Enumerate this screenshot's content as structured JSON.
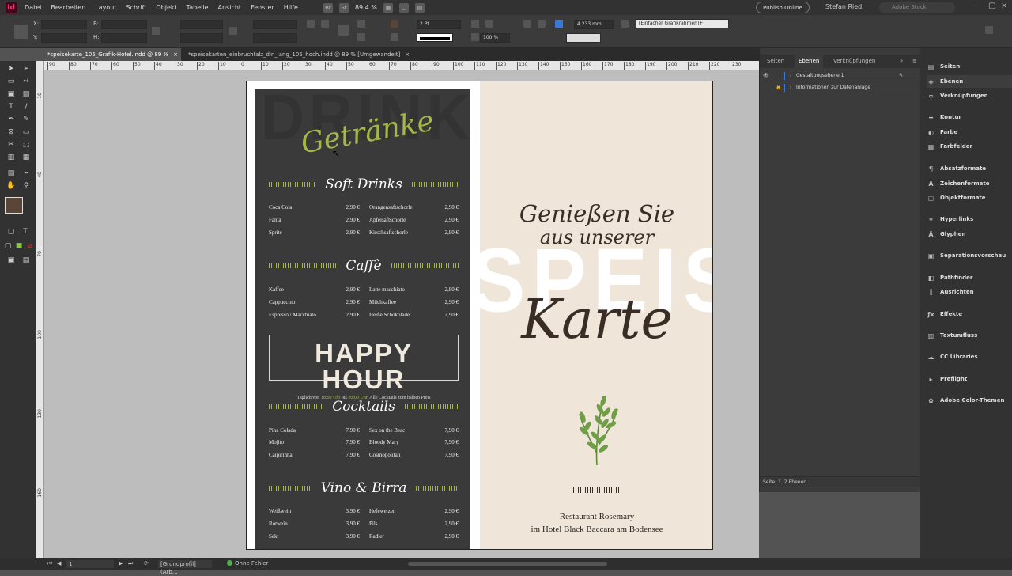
{
  "app": {
    "logo": "Id"
  },
  "menu": [
    "Datei",
    "Bearbeiten",
    "Layout",
    "Schrift",
    "Objekt",
    "Tabelle",
    "Ansicht",
    "Fenster",
    "Hilfe"
  ],
  "toolbar_top": {
    "mode_btn1": "Br",
    "mode_btn2": "St",
    "zoom": "89,4 %",
    "publish": "Publish Online",
    "user": "Stefan Riedl",
    "search_placeholder": "Adobe Stock"
  },
  "control": {
    "x_label": "X:",
    "y_label": "Y:",
    "w_label": "B:",
    "h_label": "H:",
    "stroke_weight": "2 Pt",
    "offset": "4,233 mm",
    "scale": "100 %",
    "object_style": "[Einfacher Grafikrahmen]+"
  },
  "tabs": [
    {
      "label": "*speisekarte_105_Grafik-Hotel.indd @ 89 %",
      "close": "×"
    },
    {
      "label": "*speisekarten_einbruchfalz_din_lang_105_hoch.indd @ 89 % [Umgewandelt]",
      "close": "×"
    }
  ],
  "ruler": [
    "90",
    "80",
    "70",
    "60",
    "50",
    "40",
    "30",
    "20",
    "10",
    "0",
    "10",
    "20",
    "30",
    "40",
    "50",
    "60",
    "70",
    "80",
    "90",
    "100",
    "110",
    "120",
    "130",
    "140",
    "150",
    "160",
    "170",
    "180",
    "190",
    "200",
    "210",
    "220",
    "230"
  ],
  "document": {
    "left": {
      "title": "DRINKS",
      "subtitle": "Getränke",
      "soft_drinks": {
        "heading": "Soft Drinks",
        "rows": [
          [
            "Coca Cola",
            "2,90 €",
            "Orangensaftschorle",
            "2,90 €"
          ],
          [
            "Fanta",
            "2,90 €",
            "Apfelsaftschorle",
            "2,90 €"
          ],
          [
            "Sprite",
            "2,90 €",
            "Kirschsaftschorle",
            "2,90 €"
          ]
        ]
      },
      "caffe": {
        "heading": "Caffè",
        "rows": [
          [
            "Kaffee",
            "2,90 €",
            "Latte macchiato",
            "2,90 €"
          ],
          [
            "Cappuccino",
            "2,90 €",
            "Milchkaffee",
            "2,90 €"
          ],
          [
            "Espresso / Macchiato",
            "2,90 €",
            "Heiße Schokolade",
            "2,90 €"
          ]
        ]
      },
      "happy_hour": {
        "title": "HAPPY HOUR",
        "sub_prefix": "Täglich von",
        "time1": "18:00 Uhr",
        "sub_mid": "bis",
        "time2": "20:00 Uhr.",
        "sub_suffix": "Alle Cocktails zum halben Preis"
      },
      "cocktails": {
        "heading": "Cocktails",
        "rows": [
          [
            "Pina Colada",
            "7,90 €",
            "Sex on the Beac",
            "7,90 €"
          ],
          [
            "Mojito",
            "7,90 €",
            "Bloody Mary",
            "7,90 €"
          ],
          [
            "Caipirinha",
            "7,90 €",
            "Cosmopolitan",
            "7,90 €"
          ]
        ]
      },
      "vino": {
        "heading": "Vino & Birra",
        "rows": [
          [
            "Weißwein",
            "3,90 €",
            "Hefeweizen",
            "2,90 €"
          ],
          [
            "Rotwein",
            "3,90 €",
            "Pils",
            "2,90 €"
          ],
          [
            "Sekt",
            "3,90 €",
            "Radler",
            "2,90 €"
          ]
        ]
      }
    },
    "right": {
      "bg_word": "SPEISE",
      "line1": "Genießen Sie",
      "line2": "aus unserer",
      "karte": "Karte",
      "restaurant_line1": "Restaurant Rosemary",
      "restaurant_line2": "im Hotel Black Baccara am Bodensee"
    }
  },
  "layers_panel": {
    "tabs": [
      "Seiten",
      "Ebenen",
      "Verknüpfungen"
    ],
    "layers": [
      "Gestaltungsebene 1",
      "Informationen zur Datenanlage"
    ],
    "status": "Seite: 1, 2 Ebenen"
  },
  "side_panels": [
    "Seiten",
    "Ebenen",
    "Verknüpfungen",
    "Kontur",
    "Farbe",
    "Farbfelder",
    "Absatzformate",
    "Zeichenformate",
    "Objektformate",
    "Hyperlinks",
    "Glyphen",
    "Separationsvorschau",
    "Pathfinder",
    "Ausrichten",
    "Effekte",
    "Textumfluss",
    "CC Libraries",
    "Preflight",
    "Adobe Color-Themen"
  ],
  "statusbar": {
    "page": "1",
    "profile": "[Grundprofil] (Arb...",
    "errors": "Ohne Fehler"
  },
  "colors": {
    "accent": "#a4b848",
    "dark": "#3a3a3a",
    "cream": "#efe6d9",
    "brown": "#3a2d26"
  }
}
